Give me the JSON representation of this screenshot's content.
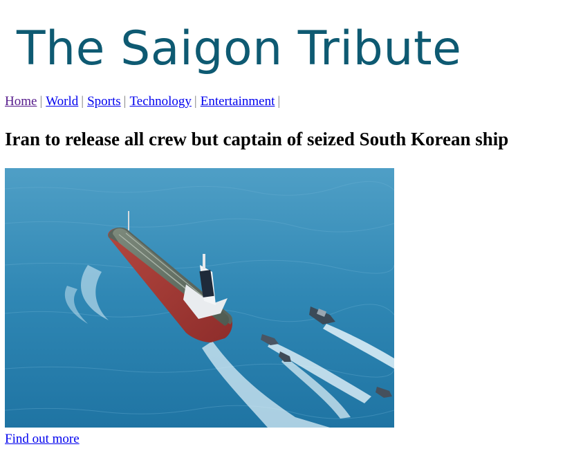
{
  "site": {
    "title": "The Saigon Tribute",
    "title_color": "#0e5a72"
  },
  "nav": {
    "items": [
      {
        "label": "Home",
        "color": "#551a8b"
      },
      {
        "label": "World",
        "color": "#0000ee"
      },
      {
        "label": "Sports",
        "color": "#0000ee"
      },
      {
        "label": "Technology",
        "color": "#0000ee"
      },
      {
        "label": "Entertainment",
        "color": "#0000ee"
      }
    ],
    "separator": "|"
  },
  "article": {
    "headline": "Iran to release all crew but captain of seized South Korean ship",
    "link_label": "Find out more",
    "link_color": "#0000ee"
  }
}
